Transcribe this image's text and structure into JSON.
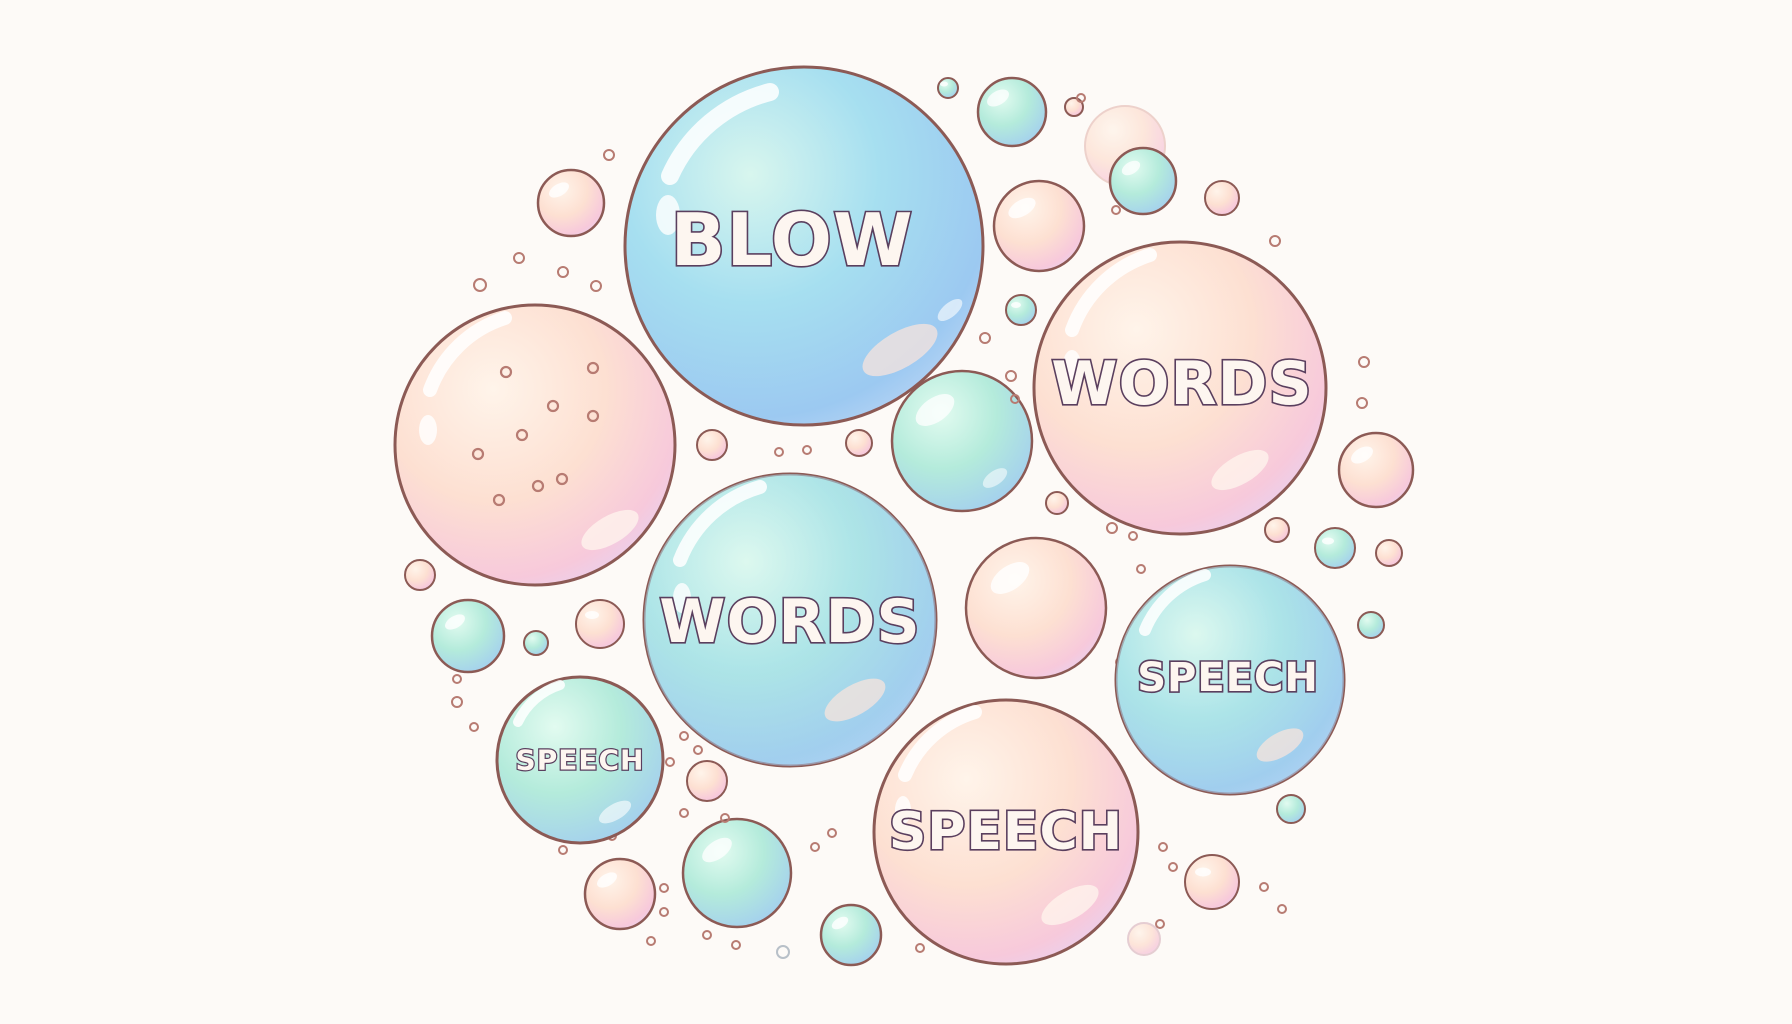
{
  "words": {
    "blow": "BLOW",
    "words_top": "WORDS",
    "words_center": "WORDS",
    "speech_right": "SPEECH",
    "speech_bottom": "SPEECH",
    "speech_left": "SPEECH"
  },
  "colors": {
    "background": "#fdfaf7",
    "bubble_blue": "#a9dcf2",
    "bubble_mint": "#b8f0dc",
    "bubble_peach": "#fbd9cf",
    "bubble_pink": "#f7c8dc",
    "outline": "#8c5a55",
    "text_outline": "#5a3f5e"
  }
}
